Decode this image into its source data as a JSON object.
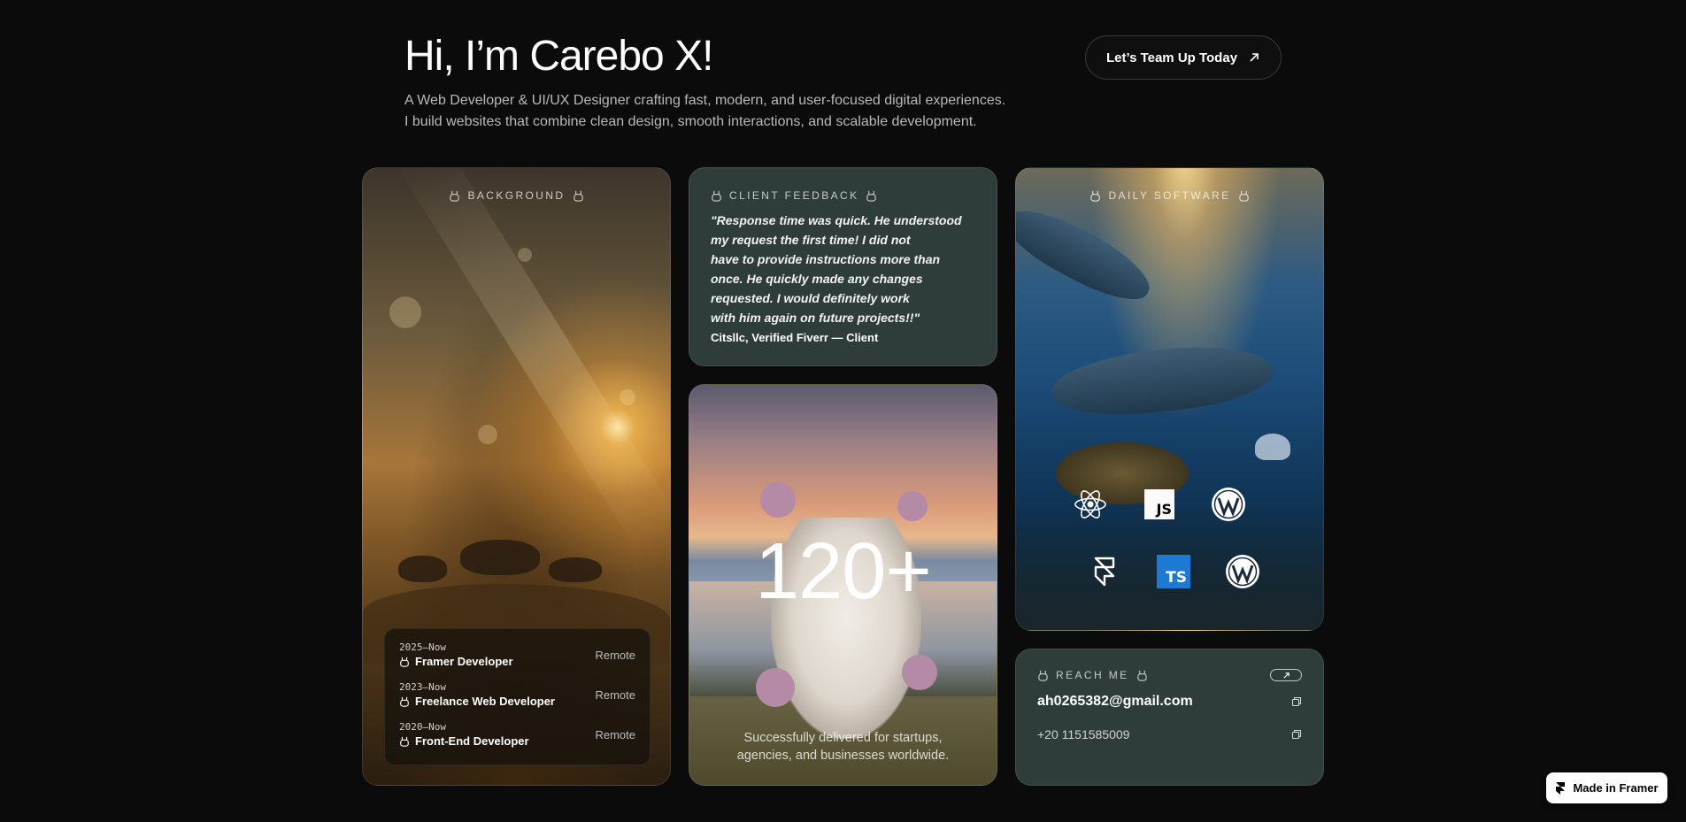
{
  "hero": {
    "title": "Hi, I’m Carebo X!",
    "subtitle_line1": "A Web Developer & UI/UX Designer crafting fast, modern, and user-focused digital experiences.",
    "subtitle_line2": "I build websites that combine clean design, smooth interactions, and scalable development.",
    "cta_label": "Let’s Team Up Today"
  },
  "background_card": {
    "tag": "BACKGROUND",
    "experience": [
      {
        "date": "2025–Now",
        "role": "Framer Developer",
        "location": "Remote"
      },
      {
        "date": "2023–Now",
        "role": "Freelance Web Developer",
        "location": "Remote"
      },
      {
        "date": "2020–Now",
        "role": "Front-End Developer",
        "location": "Remote"
      }
    ]
  },
  "feedback_card": {
    "tag": "CLIENT FEEDBACK",
    "quote_lines": [
      "\"Response time was quick. He understood",
      "my request the first time! I did not",
      "have to provide instructions more than",
      "once. He quickly made any changes",
      "requested. I would definitely work",
      "with him again on future projects!!\""
    ],
    "author": "Citsllc, Verified Fiverr — Client"
  },
  "stats_card": {
    "number": "120+",
    "desc_line1": "Successfully delivered for startups,",
    "desc_line2": "agencies, and businesses worldwide."
  },
  "software_card": {
    "tag": "DAILY SOFTWARE",
    "icons": [
      "react-icon",
      "javascript-icon",
      "wordpress-icon",
      "framer-icon",
      "typescript-icon",
      "wordpress-icon"
    ],
    "js_label": "JS",
    "ts_label": "TS"
  },
  "reach_card": {
    "tag": "REACH ME",
    "email": "ah0265382@gmail.com",
    "phone": "+20 1151585009"
  },
  "badge": {
    "label": "Made in Framer"
  },
  "colors": {
    "page_bg": "#0b0b0b",
    "card_teal": "#2f3d3a",
    "accent_white": "#ffffff"
  }
}
